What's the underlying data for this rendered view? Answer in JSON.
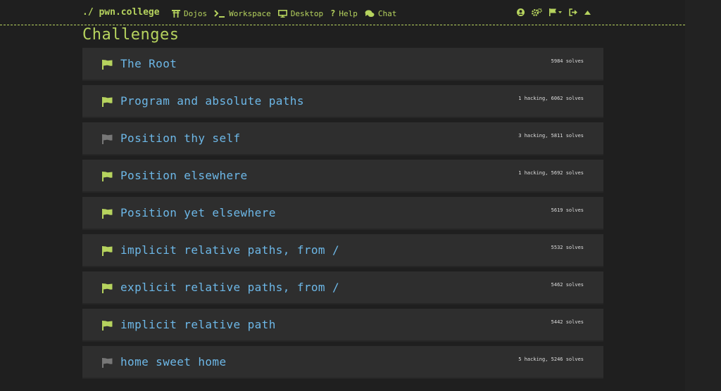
{
  "navbar": {
    "brand": "./ pwn.college",
    "links": [
      {
        "label": "Dojos",
        "icon": "torii-gate-icon"
      },
      {
        "label": "Workspace",
        "icon": "terminal-icon"
      },
      {
        "label": "Desktop",
        "icon": "desktop-icon"
      },
      {
        "label": "Help",
        "icon": "question-icon"
      },
      {
        "label": "Chat",
        "icon": "comments-icon"
      }
    ],
    "right_icons": [
      "user-circle-icon",
      "cogs-icon",
      "flag-dropdown-icon",
      "sign-out-icon",
      "caret-up-icon"
    ]
  },
  "page": {
    "title": "Challenges"
  },
  "challenges": [
    {
      "title": "The Root",
      "stats": "5984 solves",
      "solved": true
    },
    {
      "title": "Program and absolute paths",
      "stats": "1 hacking, 6062 solves",
      "solved": true
    },
    {
      "title": "Position thy self",
      "stats": "3 hacking, 5811 solves",
      "solved": false
    },
    {
      "title": "Position elsewhere",
      "stats": "1 hacking, 5692 solves",
      "solved": true
    },
    {
      "title": "Position yet elsewhere",
      "stats": "5619 solves",
      "solved": true
    },
    {
      "title": "implicit relative paths, from /",
      "stats": "5532 solves",
      "solved": true
    },
    {
      "title": "explicit relative paths, from /",
      "stats": "5462 solves",
      "solved": true
    },
    {
      "title": "implicit relative path",
      "stats": "5442 solves",
      "solved": true
    },
    {
      "title": "home sweet home",
      "stats": "5 hacking, 5246 solves",
      "solved": false
    }
  ],
  "colors": {
    "accent": "#b6d35e",
    "link": "#6db8e8",
    "flag_solved": "#b6d35e",
    "flag_unsolved": "#777777",
    "row_bg": "#2e2e2e",
    "page_bg": "#1f1f1f"
  }
}
